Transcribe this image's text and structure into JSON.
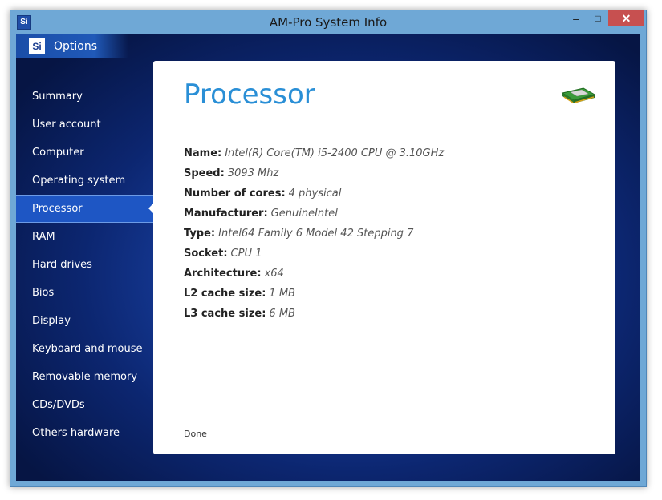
{
  "window": {
    "title": "AM-Pro System Info",
    "app_icon_text": "Si",
    "controls": {
      "minimize": "–",
      "maximize": "□",
      "close": "✕"
    }
  },
  "options": {
    "badge": "Si",
    "label": "Options"
  },
  "nav": {
    "items": [
      "Summary",
      "User account",
      "Computer",
      "Operating system",
      "Processor",
      "RAM",
      "Hard drives",
      "Bios",
      "Display",
      "Keyboard and mouse",
      "Removable memory",
      "CDs/DVDs",
      "Others hardware"
    ],
    "active": "Processor"
  },
  "panel": {
    "heading": "Processor",
    "icon": "processor-chip-icon",
    "fields": [
      {
        "label": "Name:",
        "value": "Intel(R) Core(TM) i5-2400 CPU @ 3.10GHz"
      },
      {
        "label": "Speed:",
        "value": "3093 Mhz"
      },
      {
        "label": "Number of cores:",
        "value": "4 physical"
      },
      {
        "label": "Manufacturer:",
        "value": "GenuineIntel"
      },
      {
        "label": "Type:",
        "value": "Intel64 Family 6 Model 42 Stepping 7"
      },
      {
        "label": "Socket:",
        "value": "CPU 1"
      },
      {
        "label": "Architecture:",
        "value": "x64"
      },
      {
        "label": "L2 cache size:",
        "value": "1 MB"
      },
      {
        "label": "L3 cache size:",
        "value": "6 MB"
      }
    ],
    "status": "Done"
  },
  "colors": {
    "heading": "#2a8fd6",
    "titlebar": "#6fa8d6",
    "close_button": "#c75050",
    "nav_active": "#1e56c4"
  }
}
